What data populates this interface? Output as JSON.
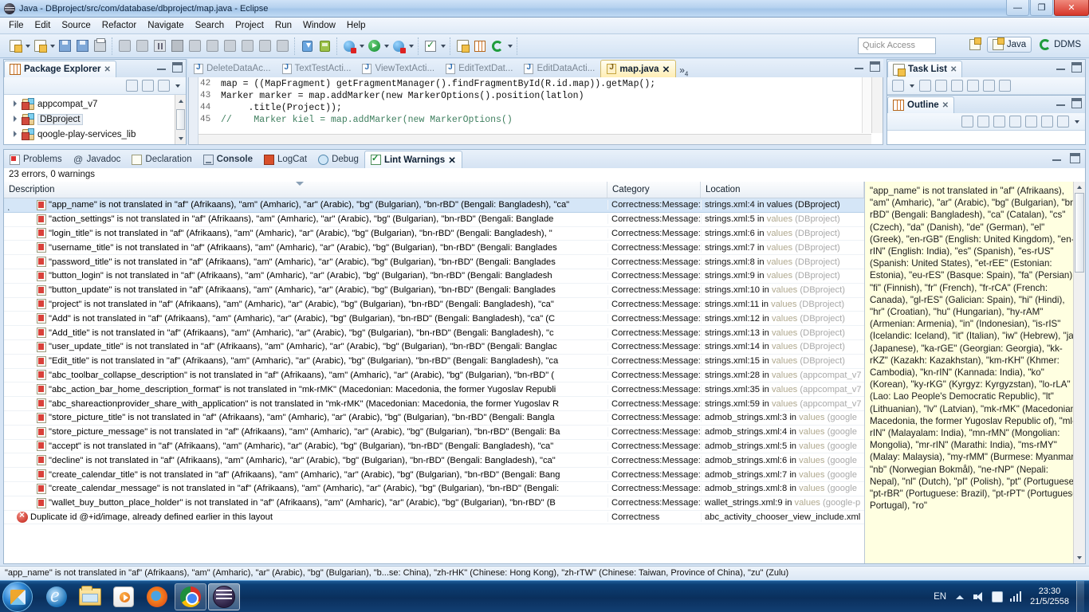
{
  "window": {
    "title": "Java - DBproject/src/com/database/dbproject/map.java - Eclipse",
    "minimize_label": "—",
    "maximize_label": "❐",
    "close_label": "✕"
  },
  "menubar": {
    "items": [
      "File",
      "Edit",
      "Source",
      "Refactor",
      "Navigate",
      "Search",
      "Project",
      "Run",
      "Window",
      "Help"
    ]
  },
  "toolbar": {
    "quick_access_placeholder": "Quick Access",
    "perspectives": [
      {
        "label": "Java",
        "active": true
      },
      {
        "label": "DDMS",
        "active": false
      }
    ]
  },
  "package_explorer": {
    "title": "Package Explorer",
    "close_label": "✕",
    "items": [
      {
        "label": "appcompat_v7",
        "selected": false
      },
      {
        "label": "DBproject",
        "selected": true
      },
      {
        "label": "qoogle-play-services_lib",
        "selected": false
      }
    ]
  },
  "editor": {
    "tabs": [
      {
        "label": "DeleteDataAc...",
        "active": false
      },
      {
        "label": "TextTestActi...",
        "active": false
      },
      {
        "label": "ViewTextActi...",
        "active": false
      },
      {
        "label": "EditTextDat...",
        "active": false
      },
      {
        "label": "EditDataActi...",
        "active": false
      },
      {
        "label": "map.java",
        "active": true
      }
    ],
    "more_indicator": "»",
    "more_count": "4",
    "close_label": "✕",
    "lines": [
      {
        "number": "42",
        "text": "map = ((MapFragment) getFragmentManager().findFragmentById(R.id.map)).getMap();"
      },
      {
        "number": "43",
        "text": "Marker marker = map.addMarker(new MarkerOptions().position(latlon)"
      },
      {
        "number": "44",
        "text": "     .title(Project));"
      },
      {
        "number": "45",
        "text": "//    Marker kiel = map.addMarker(new MarkerOptions()"
      }
    ]
  },
  "task_list": {
    "title": "Task List",
    "close_label": "✕"
  },
  "outline": {
    "title": "Outline",
    "close_label": "✕"
  },
  "lint": {
    "tabs": [
      {
        "label": "Problems",
        "icon": "problems-icon",
        "active": false
      },
      {
        "label": "Javadoc",
        "icon": "javadoc-icon",
        "active": false
      },
      {
        "label": "Declaration",
        "icon": "declaration-icon",
        "active": false
      },
      {
        "label": "Console",
        "icon": "console-icon",
        "active": false,
        "bold": true
      },
      {
        "label": "LogCat",
        "icon": "logcat-icon",
        "active": false
      },
      {
        "label": "Debug",
        "icon": "debug-icon",
        "active": false
      },
      {
        "label": "Lint Warnings",
        "icon": "lint-icon",
        "active": true
      }
    ],
    "summary": "23 errors, 0 warnings",
    "columns": {
      "description": "Description",
      "category": "Category",
      "location": "Location"
    },
    "rows": [
      {
        "desc": "\"app_name\" is not translated in \"af\" (Afrikaans), \"am\" (Amharic), \"ar\" (Arabic), \"bg\" (Bulgarian), \"bn-rBD\" (Bengali: Bangladesh), \"ca\"",
        "cat": "Correctness:Message:",
        "loc_file": "strings.xml:4 in ",
        "loc_values": "values",
        "loc_proj": " (DBproject)",
        "selected": true,
        "expander": true,
        "icon": "warning-icon"
      },
      {
        "desc": "\"action_settings\" is not translated in \"af\" (Afrikaans), \"am\" (Amharic), \"ar\" (Arabic), \"bg\" (Bulgarian), \"bn-rBD\" (Bengali: Banglade",
        "cat": "Correctness:Message:",
        "loc_file": "strings.xml:5 in ",
        "loc_values": "values",
        "loc_proj": " (DBproject)",
        "selected": false,
        "expander": false,
        "icon": "warning-icon"
      },
      {
        "desc": "\"login_title\" is not translated in \"af\" (Afrikaans), \"am\" (Amharic), \"ar\" (Arabic), \"bg\" (Bulgarian), \"bn-rBD\" (Bengali: Bangladesh), \"",
        "cat": "Correctness:Message:",
        "loc_file": "strings.xml:6 in ",
        "loc_values": "values",
        "loc_proj": " (DBproject)",
        "selected": false,
        "expander": false,
        "icon": "warning-icon"
      },
      {
        "desc": "\"username_title\" is not translated in \"af\" (Afrikaans), \"am\" (Amharic), \"ar\" (Arabic), \"bg\" (Bulgarian), \"bn-rBD\" (Bengali: Banglades",
        "cat": "Correctness:Message:",
        "loc_file": "strings.xml:7 in ",
        "loc_values": "values",
        "loc_proj": " (DBproject)",
        "selected": false,
        "expander": false,
        "icon": "warning-icon"
      },
      {
        "desc": "\"password_title\" is not translated in \"af\" (Afrikaans), \"am\" (Amharic), \"ar\" (Arabic), \"bg\" (Bulgarian), \"bn-rBD\" (Bengali: Banglades",
        "cat": "Correctness:Message:",
        "loc_file": "strings.xml:8 in ",
        "loc_values": "values",
        "loc_proj": " (DBproject)",
        "selected": false,
        "expander": false,
        "icon": "warning-icon"
      },
      {
        "desc": "\"button_login\" is not translated in \"af\" (Afrikaans), \"am\" (Amharic), \"ar\" (Arabic), \"bg\" (Bulgarian), \"bn-rBD\" (Bengali: Bangladesh",
        "cat": "Correctness:Message:",
        "loc_file": "strings.xml:9 in ",
        "loc_values": "values",
        "loc_proj": " (DBproject)",
        "selected": false,
        "expander": false,
        "icon": "warning-icon"
      },
      {
        "desc": "\"button_update\" is not translated in \"af\" (Afrikaans), \"am\" (Amharic), \"ar\" (Arabic), \"bg\" (Bulgarian), \"bn-rBD\" (Bengali: Banglades",
        "cat": "Correctness:Message:",
        "loc_file": "strings.xml:10 in ",
        "loc_values": "values",
        "loc_proj": " (DBproject)",
        "selected": false,
        "expander": false,
        "icon": "warning-icon"
      },
      {
        "desc": "\"project\" is not translated in \"af\" (Afrikaans), \"am\" (Amharic), \"ar\" (Arabic), \"bg\" (Bulgarian), \"bn-rBD\" (Bengali: Bangladesh), \"ca\"",
        "cat": "Correctness:Message:",
        "loc_file": "strings.xml:11 in ",
        "loc_values": "values",
        "loc_proj": " (DBproject)",
        "selected": false,
        "expander": false,
        "icon": "warning-icon"
      },
      {
        "desc": "\"Add\" is not translated in \"af\" (Afrikaans), \"am\" (Amharic), \"ar\" (Arabic), \"bg\" (Bulgarian), \"bn-rBD\" (Bengali: Bangladesh), \"ca\" (C",
        "cat": "Correctness:Message:",
        "loc_file": "strings.xml:12 in ",
        "loc_values": "values",
        "loc_proj": " (DBproject)",
        "selected": false,
        "expander": false,
        "icon": "warning-icon"
      },
      {
        "desc": "\"Add_title\" is not translated in \"af\" (Afrikaans), \"am\" (Amharic), \"ar\" (Arabic), \"bg\" (Bulgarian), \"bn-rBD\" (Bengali: Bangladesh), \"c",
        "cat": "Correctness:Message:",
        "loc_file": "strings.xml:13 in ",
        "loc_values": "values",
        "loc_proj": " (DBproject)",
        "selected": false,
        "expander": false,
        "icon": "warning-icon"
      },
      {
        "desc": "\"user_update_title\" is not translated in \"af\" (Afrikaans), \"am\" (Amharic), \"ar\" (Arabic), \"bg\" (Bulgarian), \"bn-rBD\" (Bengali: Banglac",
        "cat": "Correctness:Message:",
        "loc_file": "strings.xml:14 in ",
        "loc_values": "values",
        "loc_proj": " (DBproject)",
        "selected": false,
        "expander": false,
        "icon": "warning-icon"
      },
      {
        "desc": "\"Edit_title\" is not translated in \"af\" (Afrikaans), \"am\" (Amharic), \"ar\" (Arabic), \"bg\" (Bulgarian), \"bn-rBD\" (Bengali: Bangladesh), \"ca",
        "cat": "Correctness:Message:",
        "loc_file": "strings.xml:15 in ",
        "loc_values": "values",
        "loc_proj": " (DBproject)",
        "selected": false,
        "expander": false,
        "icon": "warning-icon"
      },
      {
        "desc": "\"abc_toolbar_collapse_description\" is not translated in \"af\" (Afrikaans), \"am\" (Amharic), \"ar\" (Arabic), \"bg\" (Bulgarian), \"bn-rBD\" (",
        "cat": "Correctness:Message:",
        "loc_file": "strings.xml:28 in ",
        "loc_values": "values",
        "loc_proj": " (appcompat_v7",
        "selected": false,
        "expander": false,
        "icon": "warning-icon"
      },
      {
        "desc": "\"abc_action_bar_home_description_format\" is not translated in \"mk-rMK\" (Macedonian: Macedonia, the former Yugoslav Republi",
        "cat": "Correctness:Message:",
        "loc_file": "strings.xml:35 in ",
        "loc_values": "values",
        "loc_proj": " (appcompat_v7",
        "selected": false,
        "expander": false,
        "icon": "warning-icon"
      },
      {
        "desc": "\"abc_shareactionprovider_share_with_application\" is not translated in \"mk-rMK\" (Macedonian: Macedonia, the former Yugoslav R",
        "cat": "Correctness:Message:",
        "loc_file": "strings.xml:59 in ",
        "loc_values": "values",
        "loc_proj": " (appcompat_v7",
        "selected": false,
        "expander": false,
        "icon": "warning-icon"
      },
      {
        "desc": "\"store_picture_title\" is not translated in \"af\" (Afrikaans), \"am\" (Amharic), \"ar\" (Arabic), \"bg\" (Bulgarian), \"bn-rBD\" (Bengali: Bangla",
        "cat": "Correctness:Message:",
        "loc_file": "admob_strings.xml:3 in ",
        "loc_values": "values",
        "loc_proj": " (google",
        "selected": false,
        "expander": false,
        "icon": "warning-icon"
      },
      {
        "desc": "\"store_picture_message\" is not translated in \"af\" (Afrikaans), \"am\" (Amharic), \"ar\" (Arabic), \"bg\" (Bulgarian), \"bn-rBD\" (Bengali: Ba",
        "cat": "Correctness:Message:",
        "loc_file": "admob_strings.xml:4 in ",
        "loc_values": "values",
        "loc_proj": " (google",
        "selected": false,
        "expander": false,
        "icon": "warning-icon"
      },
      {
        "desc": "\"accept\" is not translated in \"af\" (Afrikaans), \"am\" (Amharic), \"ar\" (Arabic), \"bg\" (Bulgarian), \"bn-rBD\" (Bengali: Bangladesh), \"ca\"",
        "cat": "Correctness:Message:",
        "loc_file": "admob_strings.xml:5 in ",
        "loc_values": "values",
        "loc_proj": " (google",
        "selected": false,
        "expander": false,
        "icon": "warning-icon"
      },
      {
        "desc": "\"decline\" is not translated in \"af\" (Afrikaans), \"am\" (Amharic), \"ar\" (Arabic), \"bg\" (Bulgarian), \"bn-rBD\" (Bengali: Bangladesh), \"ca\"",
        "cat": "Correctness:Message:",
        "loc_file": "admob_strings.xml:6 in ",
        "loc_values": "values",
        "loc_proj": " (google",
        "selected": false,
        "expander": false,
        "icon": "warning-icon"
      },
      {
        "desc": "\"create_calendar_title\" is not translated in \"af\" (Afrikaans), \"am\" (Amharic), \"ar\" (Arabic), \"bg\" (Bulgarian), \"bn-rBD\" (Bengali: Bang",
        "cat": "Correctness:Message:",
        "loc_file": "admob_strings.xml:7 in ",
        "loc_values": "values",
        "loc_proj": " (google",
        "selected": false,
        "expander": false,
        "icon": "warning-icon"
      },
      {
        "desc": "\"create_calendar_message\" is not translated in \"af\" (Afrikaans), \"am\" (Amharic), \"ar\" (Arabic), \"bg\" (Bulgarian), \"bn-rBD\" (Bengali:",
        "cat": "Correctness:Message:",
        "loc_file": "admob_strings.xml:8 in ",
        "loc_values": "values",
        "loc_proj": " (google",
        "selected": false,
        "expander": false,
        "icon": "warning-icon"
      },
      {
        "desc": "\"wallet_buy_button_place_holder\" is not translated in \"af\" (Afrikaans), \"am\" (Amharic), \"ar\" (Arabic), \"bg\" (Bulgarian), \"bn-rBD\" (B",
        "cat": "Correctness:Message:",
        "loc_file": "wallet_strings.xml:9 in ",
        "loc_values": "values",
        "loc_proj": " (google-p",
        "selected": false,
        "expander": false,
        "icon": "warning-icon"
      },
      {
        "desc": "Duplicate id @+id/image, already defined earlier in this layout",
        "cat": "Correctness",
        "loc_file": "abc_activity_chooser_view_include.xml",
        "loc_values": "",
        "loc_proj": "",
        "selected": false,
        "expander": false,
        "icon": "error-icon"
      }
    ],
    "detail_text": "\"app_name\" is not translated in \"af\" (Afrikaans), \"am\" (Amharic), \"ar\" (Arabic), \"bg\" (Bulgarian), \"bn-rBD\" (Bengali: Bangladesh), \"ca\" (Catalan), \"cs\" (Czech), \"da\" (Danish), \"de\" (German), \"el\" (Greek), \"en-rGB\" (English: United Kingdom), \"en-rIN\" (English: India), \"es\" (Spanish), \"es-rUS\" (Spanish: United States), \"et-rEE\" (Estonian: Estonia), \"eu-rES\" (Basque: Spain), \"fa\" (Persian), \"fi\" (Finnish), \"fr\" (French), \"fr-rCA\" (French: Canada), \"gl-rES\" (Galician: Spain), \"hi\" (Hindi), \"hr\" (Croatian), \"hu\" (Hungarian), \"hy-rAM\" (Armenian: Armenia), \"in\" (Indonesian), \"is-rIS\" (Icelandic: Iceland), \"it\" (Italian), \"iw\" (Hebrew), \"ja\" (Japanese), \"ka-rGE\" (Georgian: Georgia), \"kk-rKZ\" (Kazakh: Kazakhstan), \"km-rKH\" (Khmer: Cambodia), \"kn-rIN\" (Kannada: India), \"ko\" (Korean), \"ky-rKG\" (Kyrgyz: Kyrgyzstan), \"lo-rLA\" (Lao: Lao People's Democratic Republic), \"lt\" (Lithuanian), \"lv\" (Latvian), \"mk-rMK\" (Macedonian: Macedonia, the former Yugoslav Republic of), \"ml-rIN\" (Malayalam: India), \"mn-rMN\" (Mongolian: Mongolia), \"mr-rIN\" (Marathi: India), \"ms-rMY\" (Malay: Malaysia), \"my-rMM\" (Burmese: Myanmar), \"nb\" (Norwegian Bokmål), \"ne-rNP\" (Nepali: Nepal), \"nl\" (Dutch), \"pl\" (Polish), \"pt\" (Portuguese), \"pt-rBR\" (Portuguese: Brazil), \"pt-rPT\" (Portuguese: Portugal), \"ro\""
  },
  "statusbar": {
    "text": "\"app_name\" is not translated in \"af\" (Afrikaans), \"am\" (Amharic), \"ar\" (Arabic), \"bg\" (Bulgarian), \"b...se: China), \"zh-rHK\" (Chinese: Hong Kong), \"zh-rTW\" (Chinese: Taiwan, Province of China), \"zu\" (Zulu)"
  },
  "taskbar": {
    "items": [
      {
        "name": "internet-explorer",
        "running": false,
        "active": false
      },
      {
        "name": "file-explorer",
        "running": false,
        "active": false
      },
      {
        "name": "media-player",
        "running": false,
        "active": false
      },
      {
        "name": "firefox",
        "running": false,
        "active": false
      },
      {
        "name": "chrome",
        "running": true,
        "active": false
      },
      {
        "name": "eclipse",
        "running": true,
        "active": true
      }
    ],
    "tray": {
      "language": "EN",
      "time": "23:30",
      "date": "21/5/2558"
    }
  }
}
